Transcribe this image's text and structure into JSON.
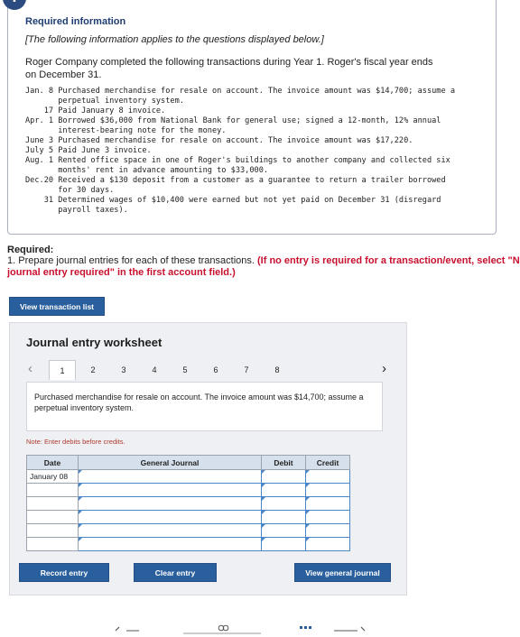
{
  "info": {
    "badge": "!",
    "title": "Required information",
    "italic_note": "[The following information applies to the questions displayed below.]",
    "intro": "Roger Company completed the following transactions during Year 1. Roger's fiscal year ends on December 31.",
    "transactions": "Jan. 8 Purchased merchandise for resale on account. The invoice amount was $14,700; assume a\n       perpetual inventory system.\n    17 Paid January 8 invoice.\nApr. 1 Borrowed $36,000 from National Bank for general use; signed a 12-month, 12% annual\n       interest-bearing note for the money.\nJune 3 Purchased merchandise for resale on account. The invoice amount was $17,220.\nJuly 5 Paid June 3 invoice.\nAug. 1 Rented office space in one of Roger's buildings to another company and collected six\n       months' rent in advance amounting to $33,000.\nDec.20 Received a $130 deposit from a customer as a guarantee to return a trailer borrowed\n       for 30 days.\n    31 Determined wages of $10,400 were earned but not yet paid on December 31 (disregard\n       payroll taxes)."
  },
  "required": {
    "heading": "Required:",
    "text": "1. Prepare journal entries for each of these transactions.",
    "red_text": "(If no entry is required for a transaction/event, select \"No journal entry required\" in the first account field.)"
  },
  "buttons": {
    "view_transactions": "View transaction list",
    "record_entry": "Record entry",
    "clear_entry": "Clear entry",
    "view_general_journal": "View general journal"
  },
  "worksheet": {
    "title": "Journal entry worksheet",
    "tabs": [
      "1",
      "2",
      "3",
      "4",
      "5",
      "6",
      "7",
      "8"
    ],
    "active_tab": "1",
    "prev_arrow": "‹",
    "next_arrow": "›",
    "description": "Purchased merchandise for resale on account. The invoice amount was $14,700; assume a perpetual inventory system.",
    "note": "Note: Enter debits before credits.",
    "columns": {
      "date": "Date",
      "journal": "General Journal",
      "debit": "Debit",
      "credit": "Credit"
    },
    "first_date": "January 08"
  }
}
